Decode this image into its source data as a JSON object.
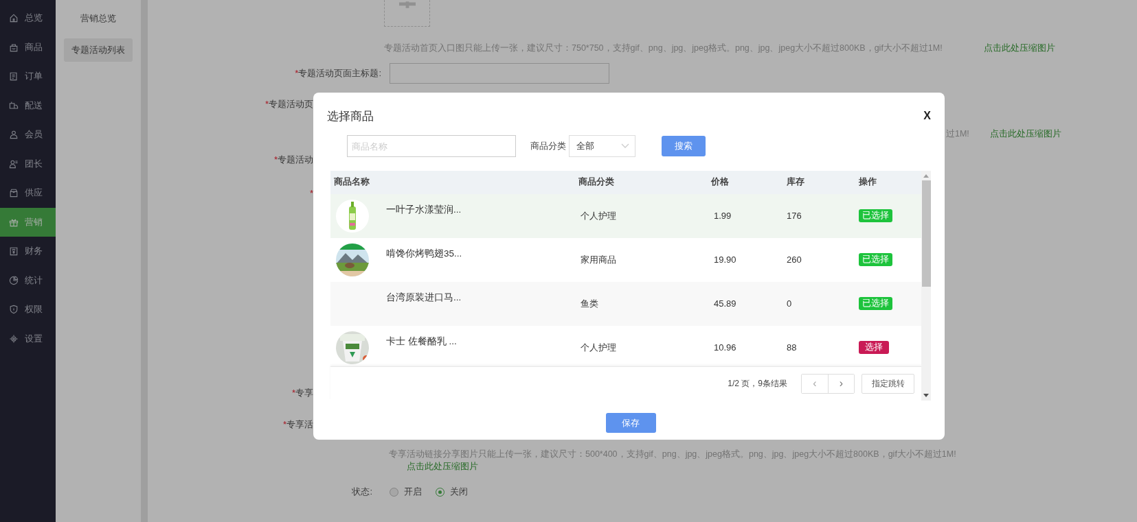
{
  "sidebar": {
    "items": [
      {
        "label": "总览",
        "selected": false
      },
      {
        "label": "商品",
        "selected": false
      },
      {
        "label": "订单",
        "selected": false
      },
      {
        "label": "配送",
        "selected": false
      },
      {
        "label": "会员",
        "selected": false
      },
      {
        "label": "团长",
        "selected": false
      },
      {
        "label": "供应",
        "selected": false
      },
      {
        "label": "营销",
        "selected": true
      },
      {
        "label": "财务",
        "selected": false
      },
      {
        "label": "统计",
        "selected": false
      },
      {
        "label": "权限",
        "selected": false
      },
      {
        "label": "设置",
        "selected": false
      }
    ]
  },
  "submenu": {
    "items": [
      {
        "label": "营销总览",
        "selected": false
      },
      {
        "label": "专题活动列表",
        "selected": true
      }
    ]
  },
  "form": {
    "rows": [
      {
        "kind": "upload"
      },
      {
        "kind": "hint",
        "text": "专题活动首页入口图只能上传一张，建议尺寸：750*750，支持gif、png、jpg、jpeg格式。png、jpg、jpeg大小不超过800KB，gif大小不超过1M!",
        "link": "点击此处压缩图片"
      },
      {
        "kind": "field",
        "label": "专题活动页面主标题:",
        "mark": "*"
      },
      {
        "kind": "cut",
        "label": "专题活动页",
        "mark": "*"
      },
      {
        "kind": "fragment",
        "text": "过1M!",
        "link": "点击此处压缩图片"
      },
      {
        "kind": "cut",
        "label": "专题活动",
        "mark": "*"
      },
      {
        "kind": "cut",
        "mark": "*"
      },
      {
        "kind": "cut",
        "label": "专享",
        "mark": "*"
      },
      {
        "kind": "cut",
        "label": "专享活",
        "mark": "*"
      },
      {
        "kind": "hint2",
        "text": "专享活动链接分享图片只能上传一张，建议尺寸：500*400，支持gif、png、jpg、jpeg格式。png、jpg、jpeg大小不超过800KB，gif大小不超过1M!",
        "link": "点击此处压缩图片"
      },
      {
        "kind": "status",
        "label": "状态:",
        "options": [
          {
            "label": "开启",
            "selected": false
          },
          {
            "label": "关闭",
            "selected": true
          }
        ]
      }
    ]
  },
  "modal": {
    "title": "选择商品",
    "close": "X",
    "search": {
      "placeholder": "商品名称",
      "category_label": "商品分类",
      "category_value": "全部",
      "button": "搜索"
    },
    "table": {
      "columns": [
        "商品名称",
        "商品分类",
        "价格",
        "库存",
        "操作"
      ],
      "rows": [
        {
          "name": "一叶子水漾莹润...",
          "category": "个人护理",
          "price": "1.99",
          "stock": "176",
          "action": "已选择",
          "selected": true,
          "hovered": true
        },
        {
          "name": "啃馋你烤鸭翅35...",
          "category": "家用商品",
          "price": "19.90",
          "stock": "260",
          "action": "已选择",
          "selected": true,
          "hovered": false
        },
        {
          "name": "台湾原装进口马...",
          "category": "鱼类",
          "price": "45.89",
          "stock": "0",
          "action": "已选择",
          "selected": true,
          "hovered": false
        },
        {
          "name": "卡士 佐餐酪乳 ...",
          "category": "个人护理",
          "price": "10.96",
          "stock": "88",
          "action": "选择",
          "selected": false,
          "hovered": false
        }
      ]
    },
    "pagination": {
      "summary": "1/2 页，9条结果",
      "prev": "‹",
      "next": "›",
      "jump": "指定跳转"
    },
    "save": "保存"
  }
}
